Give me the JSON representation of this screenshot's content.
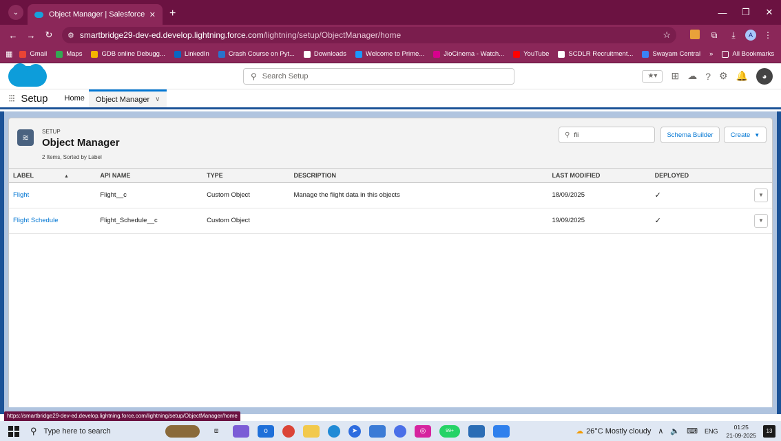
{
  "browser": {
    "tab_title": "Object Manager | Salesforce",
    "url_host": "smartbridge29-dev-ed.develop.lightning.force.com",
    "url_path": "/lightning/setup/ObjectManager/home",
    "profile_initial": "A",
    "bookmarks": [
      {
        "label": "Gmail",
        "icon": "gmail-icon",
        "color": "#ea4335"
      },
      {
        "label": "Maps",
        "icon": "maps-icon",
        "color": "#34a853"
      },
      {
        "label": "GDB online Debugg...",
        "icon": "gdb-icon",
        "color": "#f4b400"
      },
      {
        "label": "LinkedIn",
        "icon": "linkedin-icon",
        "color": "#0a66c2"
      },
      {
        "label": "Crash Course on Pyt...",
        "icon": "coursera-icon",
        "color": "#2a73cc"
      },
      {
        "label": "Downloads",
        "icon": "download-icon",
        "color": "#ffffff"
      },
      {
        "label": "Welcome to Prime...",
        "icon": "prime-icon",
        "color": "#1a98ff"
      },
      {
        "label": "JioCinema - Watch...",
        "icon": "jiocinema-icon",
        "color": "#d9008d"
      },
      {
        "label": "YouTube",
        "icon": "youtube-icon",
        "color": "#ff0000"
      },
      {
        "label": "SCDLR Recruitment...",
        "icon": "scdlr-icon",
        "color": "#ffffff"
      },
      {
        "label": "Swayam Central",
        "icon": "swayam-icon",
        "color": "#3b82f6"
      }
    ],
    "more_bookmarks": "»",
    "all_bookmarks": "All Bookmarks",
    "status_url": "https://smartbridge29-dev-ed.develop.lightning.force.com/lightning/setup/ObjectManager/home"
  },
  "sf": {
    "search_placeholder": "Search Setup",
    "app_name": "Setup",
    "nav_home": "Home",
    "nav_active": "Object Manager"
  },
  "page": {
    "crumb": "SETUP",
    "title": "Object Manager",
    "item_count": "2 Items, Sorted by Label",
    "quick_find_value": "fli",
    "schema_builder": "Schema Builder",
    "create": "Create"
  },
  "table": {
    "columns": [
      "LABEL",
      "API NAME",
      "TYPE",
      "DESCRIPTION",
      "LAST MODIFIED",
      "DEPLOYED"
    ],
    "rows": [
      {
        "label": "Flight",
        "api_name": "Flight__c",
        "type": "Custom Object",
        "description": "Manage the flight data in this objects",
        "last_modified": "18/09/2025",
        "deployed": "✓"
      },
      {
        "label": "Flight Schedule",
        "api_name": "Flight_Schedule__c",
        "type": "Custom Object",
        "description": "",
        "last_modified": "19/09/2025",
        "deployed": "✓"
      }
    ]
  },
  "taskbar": {
    "search_placeholder": "Type here to search",
    "weather": "26°C  Mostly cloudy",
    "lang": "ENG",
    "time": "01:25",
    "date": "21-09-2025",
    "notification_count": "13",
    "whatsapp_badge": "99+"
  },
  "colors": {
    "browser_frame": "#8b2759",
    "sf_blue": "#0176d3",
    "sf_cloud": "#0d9dda",
    "banner": "#1b5297"
  }
}
